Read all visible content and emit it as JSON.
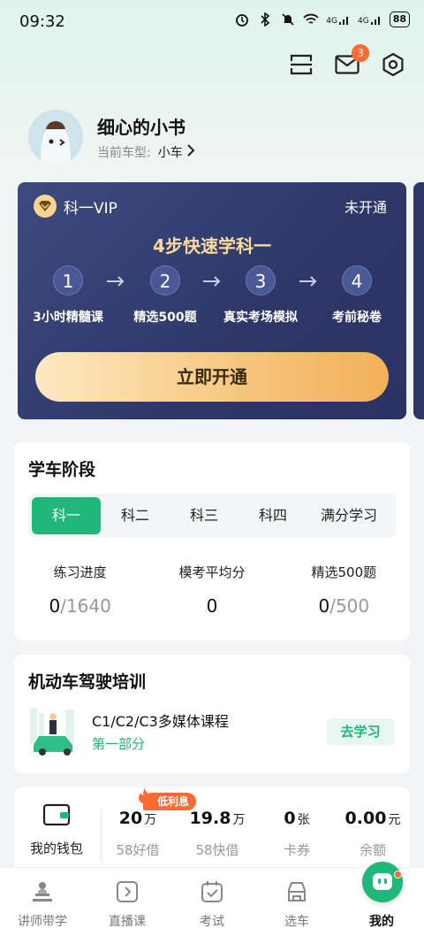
{
  "status_bar": {
    "time": "09:32",
    "signal_labels": [
      "4G",
      "4G"
    ],
    "battery": "88",
    "icons": [
      "alarm-icon",
      "bluetooth-icon",
      "mute-icon",
      "wifi-icon",
      "signal-icon",
      "signal-icon",
      "battery-icon"
    ]
  },
  "header": {
    "icons": [
      "scan-icon",
      "mail-icon",
      "settings-icon"
    ],
    "mail_badge": "3"
  },
  "profile": {
    "name": "细心的小书",
    "car_label": "当前车型:",
    "car_value": "小车",
    "chevron": ">"
  },
  "vip": {
    "label": "科一VIP",
    "status": "未开通",
    "title": "4步快速学科一",
    "steps": [
      {
        "num": "1",
        "label": "3小时精髓课"
      },
      {
        "num": "2",
        "label": "精选500题"
      },
      {
        "num": "3",
        "label": "真实考场模拟"
      },
      {
        "num": "4",
        "label": "考前秘卷"
      }
    ],
    "button": "立即开通",
    "colors": {
      "card": "#2e3768",
      "title": "#f8d9a0",
      "button": "#f6c57c"
    }
  },
  "stage": {
    "title": "学车阶段",
    "tabs": [
      "科一",
      "科二",
      "科三",
      "科四",
      "满分学习"
    ],
    "active_tab": "科一",
    "stats": [
      {
        "label": "练习进度",
        "value": "0",
        "total": "/1640"
      },
      {
        "label": "模考平均分",
        "value": "0",
        "total": ""
      },
      {
        "label": "精选500题",
        "value": "0",
        "total": "/500"
      }
    ]
  },
  "training": {
    "title": "机动车驾驶培训",
    "course_title": "C1/C2/C3多媒体课程",
    "course_sub": "第一部分",
    "button": "去学习"
  },
  "wallet": {
    "label": "我的钱包",
    "tag": "低利息",
    "items": [
      {
        "value": "20",
        "unit": "万",
        "sub": "58好借"
      },
      {
        "value": "19.8",
        "unit": "万",
        "sub": "58快借"
      },
      {
        "value": "0",
        "unit": "张",
        "sub": "卡券"
      },
      {
        "value": "0.00",
        "unit": "元",
        "sub": "余额"
      }
    ]
  },
  "nav": {
    "items": [
      {
        "label": "讲师带学",
        "icon": "teacher-icon"
      },
      {
        "label": "直播课",
        "icon": "live-icon"
      },
      {
        "label": "考试",
        "icon": "exam-icon"
      },
      {
        "label": "选车",
        "icon": "car-icon"
      },
      {
        "label": "我的",
        "icon": "mine-icon"
      }
    ],
    "active": "我的",
    "accent": "#1fb77a"
  }
}
